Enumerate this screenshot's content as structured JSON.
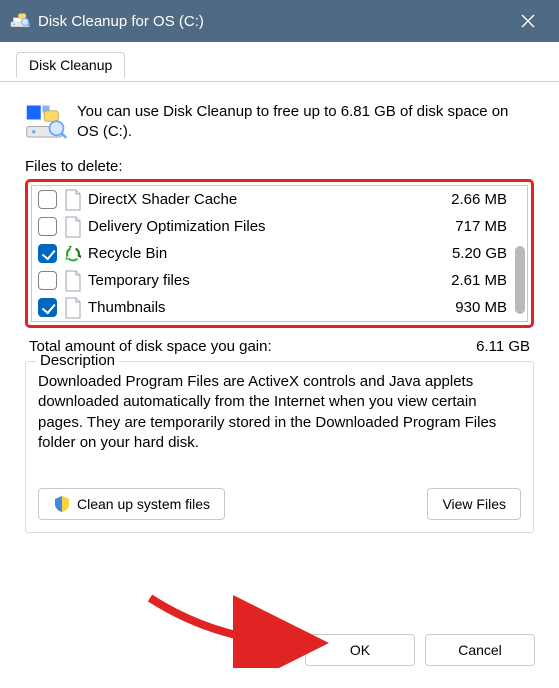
{
  "titlebar": {
    "title": "Disk Cleanup for OS (C:)"
  },
  "tab": {
    "label": "Disk Cleanup"
  },
  "intro": {
    "text": "You can use Disk Cleanup to free up to 6.81 GB of disk space on OS (C:)."
  },
  "files_label": "Files to delete:",
  "files": [
    {
      "name": "DirectX Shader Cache",
      "size": "2.66 MB",
      "checked": false,
      "icon": "page"
    },
    {
      "name": "Delivery Optimization Files",
      "size": "717 MB",
      "checked": false,
      "icon": "page"
    },
    {
      "name": "Recycle Bin",
      "size": "5.20 GB",
      "checked": true,
      "icon": "recycle"
    },
    {
      "name": "Temporary files",
      "size": "2.61 MB",
      "checked": false,
      "icon": "page"
    },
    {
      "name": "Thumbnails",
      "size": "930 MB",
      "checked": true,
      "icon": "page"
    }
  ],
  "total": {
    "label": "Total amount of disk space you gain:",
    "value": "6.11 GB"
  },
  "description": {
    "legend": "Description",
    "body": "Downloaded Program Files are ActiveX controls and Java applets downloaded automatically from the Internet when you view certain pages. They are temporarily stored in the Downloaded Program Files folder on your hard disk."
  },
  "buttons": {
    "cleanup_system": "Clean up system files",
    "view_files": "View Files",
    "ok": "OK",
    "cancel": "Cancel"
  }
}
